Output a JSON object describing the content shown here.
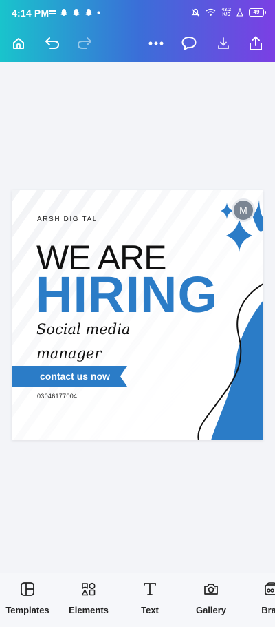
{
  "status_bar": {
    "time": "4:14 PM",
    "net_speed_value": "43.2",
    "net_speed_unit": "K/S",
    "battery": "49"
  },
  "toolbar": {
    "icons": [
      "home-icon",
      "undo-icon",
      "redo-icon",
      "more-icon",
      "comment-icon",
      "download-icon",
      "share-icon"
    ]
  },
  "design": {
    "brand": "ARSH DIGITAL",
    "headline_top": "WE ARE",
    "headline_main": "HIRING",
    "role_line1": "Social media",
    "role_line2": "manager",
    "cta": "contact  us now",
    "phone": "03046177004",
    "collaborator_initial": "M",
    "accent_color": "#2b7cc7"
  },
  "bottom_nav": {
    "items": [
      {
        "label": "Templates",
        "icon": "templates-icon"
      },
      {
        "label": "Elements",
        "icon": "elements-icon"
      },
      {
        "label": "Text",
        "icon": "text-icon"
      },
      {
        "label": "Gallery",
        "icon": "camera-icon"
      },
      {
        "label": "Bran",
        "icon": "brand-icon"
      }
    ]
  }
}
